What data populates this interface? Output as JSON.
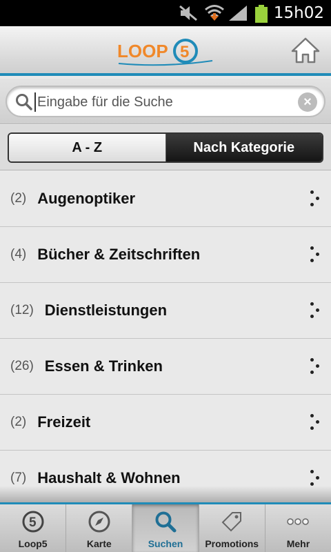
{
  "status_bar": {
    "time": "15h02",
    "icons": [
      "mute-icon",
      "wifi-icon",
      "signal-icon",
      "battery-icon"
    ]
  },
  "header": {
    "logo_text": "LOOP",
    "logo_badge": "5",
    "home_icon": "home-icon"
  },
  "search": {
    "placeholder": "Eingabe für die Suche",
    "value": "",
    "icon": "search-icon",
    "clear_icon": "clear-icon"
  },
  "segments": {
    "a_z": "A - Z",
    "category": "Nach Kategorie",
    "selected": "category"
  },
  "categories": [
    {
      "count": "(2)",
      "label": "Augenoptiker"
    },
    {
      "count": "(4)",
      "label": "Bücher & Zeitschriften"
    },
    {
      "count": "(12)",
      "label": "Dienstleistungen"
    },
    {
      "count": "(26)",
      "label": "Essen & Trinken"
    },
    {
      "count": "(2)",
      "label": "Freizeit"
    },
    {
      "count": "(7)",
      "label": "Haushalt & Wohnen"
    }
  ],
  "tabs": [
    {
      "label": "Loop5",
      "icon": "loop5-icon"
    },
    {
      "label": "Karte",
      "icon": "compass-icon"
    },
    {
      "label": "Suchen",
      "icon": "search-icon",
      "active": true
    },
    {
      "label": "Promotions",
      "icon": "tag-icon"
    },
    {
      "label": "Mehr",
      "icon": "more-icon"
    }
  ],
  "colors": {
    "accent": "#1f8bb8",
    "logo_orange": "#f0882a"
  }
}
